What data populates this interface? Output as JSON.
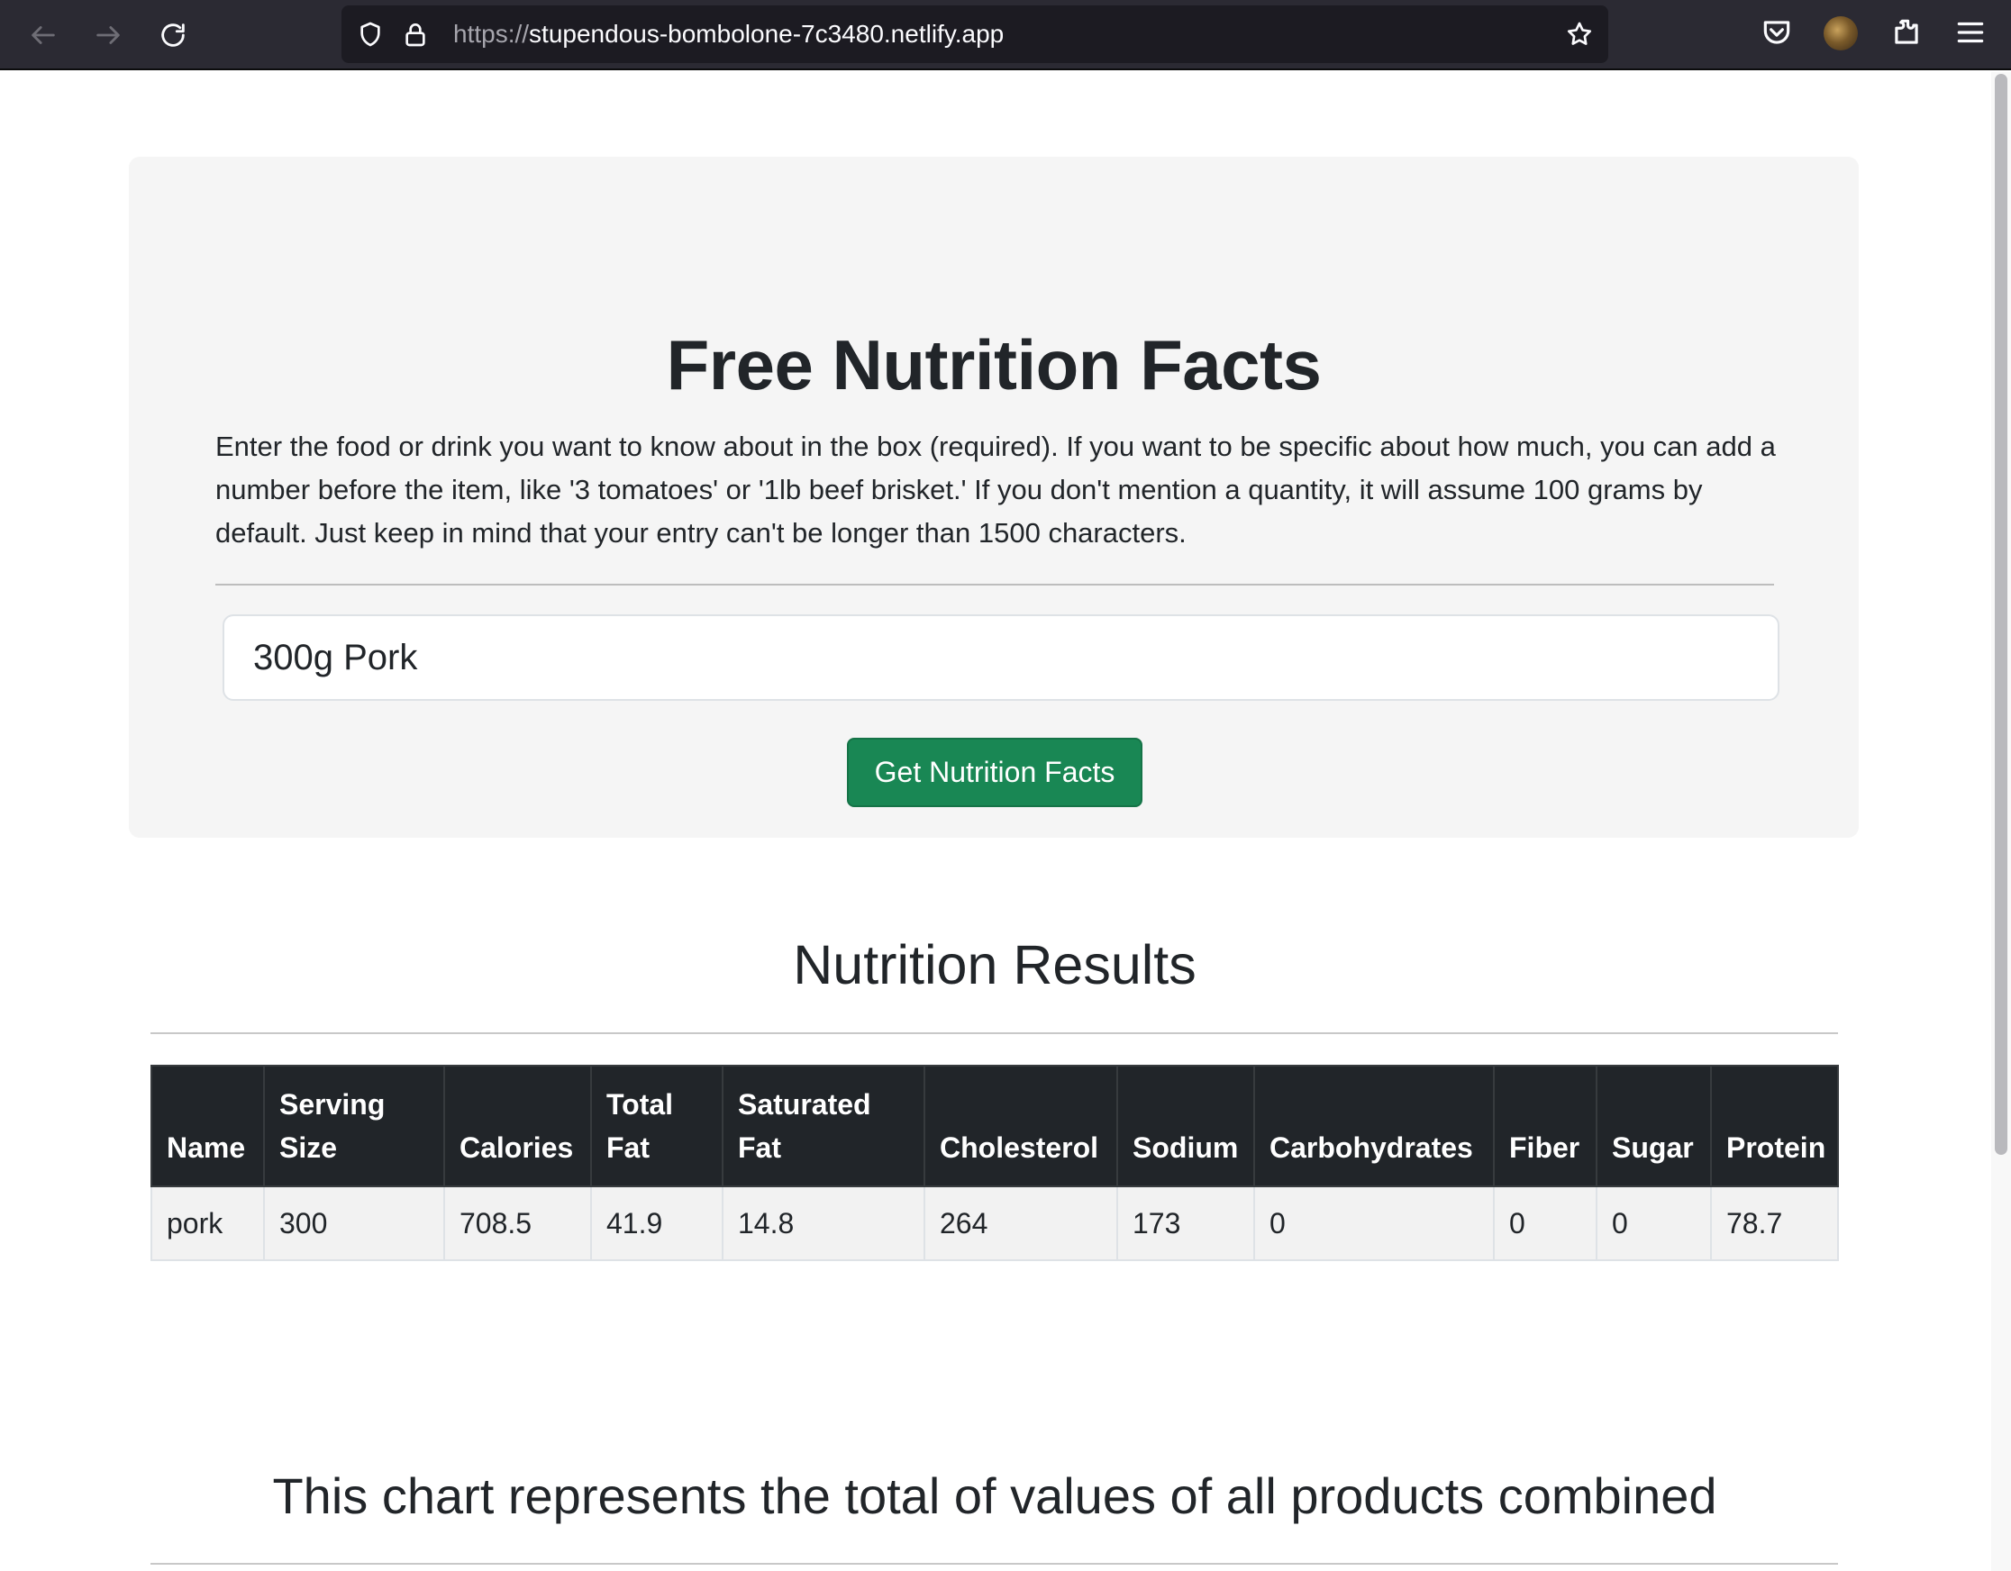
{
  "browser": {
    "url_protocol": "https://",
    "url_host": "stupendous-bombolone-7c3480.netlify.app",
    "icons": [
      "back-icon",
      "forward-icon",
      "reload-icon",
      "shield-icon",
      "lock-icon",
      "star-icon",
      "pocket-icon",
      "avatar",
      "extensions-icon",
      "menu-icon"
    ]
  },
  "hero": {
    "title": "Free Nutrition Facts",
    "description": "Enter the food or drink you want to know about in the box (required). If you want to be specific about how much, you can add a number before the item, like '3 tomatoes' or '1lb beef brisket.' If you don't mention a quantity, it will assume 100 grams by default. Just keep in mind that your entry can't be longer than 1500 characters.",
    "input_value": "300g Pork",
    "button_label": "Get Nutrition Facts"
  },
  "results": {
    "title": "Nutrition Results",
    "columns": [
      "Name",
      "Serving Size",
      "Calories",
      "Total Fat",
      "Saturated Fat",
      "Cholesterol",
      "Sodium",
      "Carbohydrates",
      "Fiber",
      "Sugar",
      "Protein"
    ],
    "rows": [
      [
        "pork",
        "300",
        "708.5",
        "41.9",
        "14.8",
        "264",
        "173",
        "0",
        "0",
        "0",
        "78.7"
      ]
    ]
  },
  "chart_section": {
    "title": "This chart represents the total of values of all products combined"
  },
  "colors": {
    "chrome_bg": "#2b2a33",
    "urlbar_bg": "#1c1b22",
    "hero_bg": "#f5f5f5",
    "button_bg": "#198754",
    "table_header_bg": "#212529",
    "table_row_bg": "#f2f2f2"
  }
}
